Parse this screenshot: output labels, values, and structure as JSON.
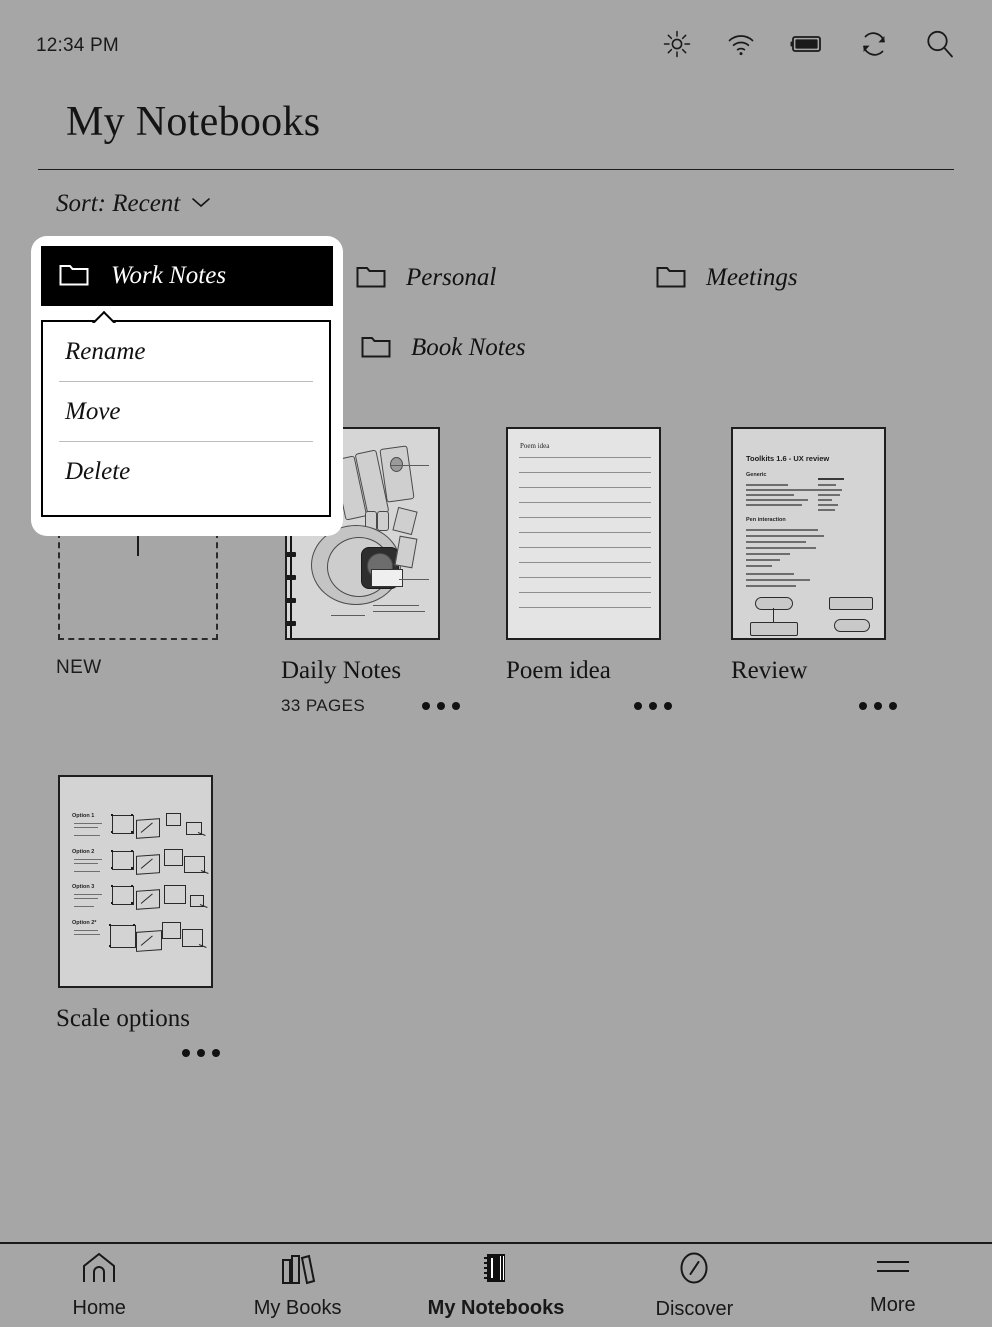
{
  "statusbar": {
    "time": "12:34 PM",
    "icons": [
      {
        "name": "brightness-icon",
        "label": "Brightness"
      },
      {
        "name": "wifi-icon",
        "label": "Wi-Fi"
      },
      {
        "name": "battery-icon",
        "label": "Battery"
      },
      {
        "name": "sync-icon",
        "label": "Sync"
      },
      {
        "name": "search-icon",
        "label": "Search"
      }
    ]
  },
  "header": {
    "title": "My Notebooks",
    "sort_label": "Sort: Recent"
  },
  "folders": [
    {
      "name": "Work Notes"
    },
    {
      "name": "Personal"
    },
    {
      "name": "Meetings"
    },
    {
      "name": "Book Notes"
    }
  ],
  "new_tile": {
    "label": "NEW"
  },
  "notebooks": [
    {
      "title": "Daily Notes",
      "pages": "33 PAGES",
      "thumb_kind": "sketch"
    },
    {
      "title": "Poem idea",
      "pages": "",
      "thumb_kind": "ruled",
      "thumb_heading": "Poem idea"
    },
    {
      "title": "Review",
      "pages": "",
      "thumb_kind": "document",
      "thumb_heading": "Toolkits 1.6 - UX review",
      "thumb_sections": [
        "Generic",
        "Pen interaction"
      ]
    },
    {
      "title": "Scale options",
      "pages": "",
      "thumb_kind": "options",
      "thumb_options": [
        "Option 1",
        "Option 2",
        "Option 3",
        "Option 2*"
      ]
    }
  ],
  "context_menu": {
    "folder_name": "Work Notes",
    "items": [
      {
        "label": "Rename"
      },
      {
        "label": "Move"
      },
      {
        "label": "Delete"
      }
    ]
  },
  "navbar": {
    "items": [
      {
        "label": "Home",
        "icon": "home-icon",
        "active": false
      },
      {
        "label": "My Books",
        "icon": "books-icon",
        "active": false
      },
      {
        "label": "My Notebooks",
        "icon": "notebook-icon",
        "active": true
      },
      {
        "label": "Discover",
        "icon": "compass-icon",
        "active": false
      },
      {
        "label": "More",
        "icon": "hamburger-icon",
        "active": false
      }
    ]
  },
  "colors": {
    "background": "#a6a6a6",
    "ink": "#141414",
    "paper": "#d8d8d8",
    "menu_bg": "#ffffff",
    "menu_header_bg": "#000000"
  }
}
